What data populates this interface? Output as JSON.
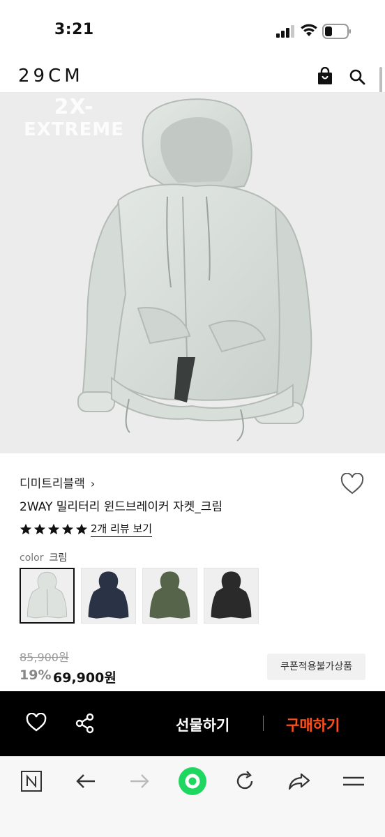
{
  "status": {
    "time": "3:21"
  },
  "header": {
    "logo": "29CM"
  },
  "hero": {
    "watermark_line1": "2X-",
    "watermark_line2": "EXTREME"
  },
  "product": {
    "brand": "디미트리블랙",
    "brand_chevron": "›",
    "name": "2WAY 밀리터리 윈드브레이커 자켓_크림",
    "rating": 5,
    "review_link": "2개 리뷰 보기",
    "color_label": "color",
    "color_value": "크림",
    "swatches": [
      {
        "name": "크림",
        "color": "#dde2de",
        "selected": true
      },
      {
        "name": "네이비",
        "color": "#2a3245",
        "selected": false
      },
      {
        "name": "카키",
        "color": "#566449",
        "selected": false
      },
      {
        "name": "블랙",
        "color": "#2a2a2a",
        "selected": false
      }
    ],
    "original_price": "85,900원",
    "discount": "19%",
    "price": "69,900원",
    "coupon_badge": "쿠폰적용불가상품"
  },
  "action_bar": {
    "gift_label": "선물하기",
    "buy_label": "구매하기",
    "buy_color": "#ff4f1a"
  },
  "browser_bar": {
    "icons": [
      "naver-n-icon",
      "back-arrow-icon",
      "forward-arrow-icon",
      "home-dot-icon",
      "refresh-icon",
      "share-arrow-icon",
      "menu-icon"
    ],
    "accent": "#1ed760"
  }
}
